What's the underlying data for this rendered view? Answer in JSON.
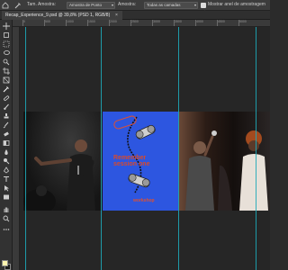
{
  "options_bar": {
    "sample_size_label": "Tam. Amostra:",
    "sample_size_value": "Amostra de Ponto",
    "sample_label": "Amostra:",
    "sample_value": "Todas as camadas",
    "show_ring_label": "Mostrar anel de amostragem",
    "show_ring_checked": true
  },
  "document": {
    "tab_title": "Recap_Experience_9.psd @ 39,8% (PSD 1, RGB/8)",
    "close_label": "×"
  },
  "ruler": {
    "top_ticks": [
      "0",
      "500",
      "1000",
      "1500",
      "2000",
      "2500",
      "3000",
      "3500",
      "4000",
      "4500",
      "5000"
    ]
  },
  "poster": {
    "title": "Remember session one",
    "tagline": "workshop",
    "background_color": "#2d56e0",
    "accent_color": "#e05030"
  },
  "colors": {
    "foreground": "#fff4b0",
    "background": "#1b1b1b",
    "guide": "#1ea8b8"
  },
  "toolbar": {
    "tools": [
      "move-icon",
      "artboard-icon",
      "marquee-icon",
      "lasso-icon",
      "quick-select-icon",
      "crop-icon",
      "frame-icon",
      "eyedropper-icon",
      "healing-brush-icon",
      "brush-icon",
      "clone-stamp-icon",
      "history-brush-icon",
      "eraser-icon",
      "gradient-icon",
      "blur-icon",
      "dodge-icon",
      "pen-icon",
      "type-icon",
      "path-select-icon",
      "rectangle-icon",
      "hand-icon",
      "zoom-icon",
      "more-tools-icon"
    ]
  }
}
